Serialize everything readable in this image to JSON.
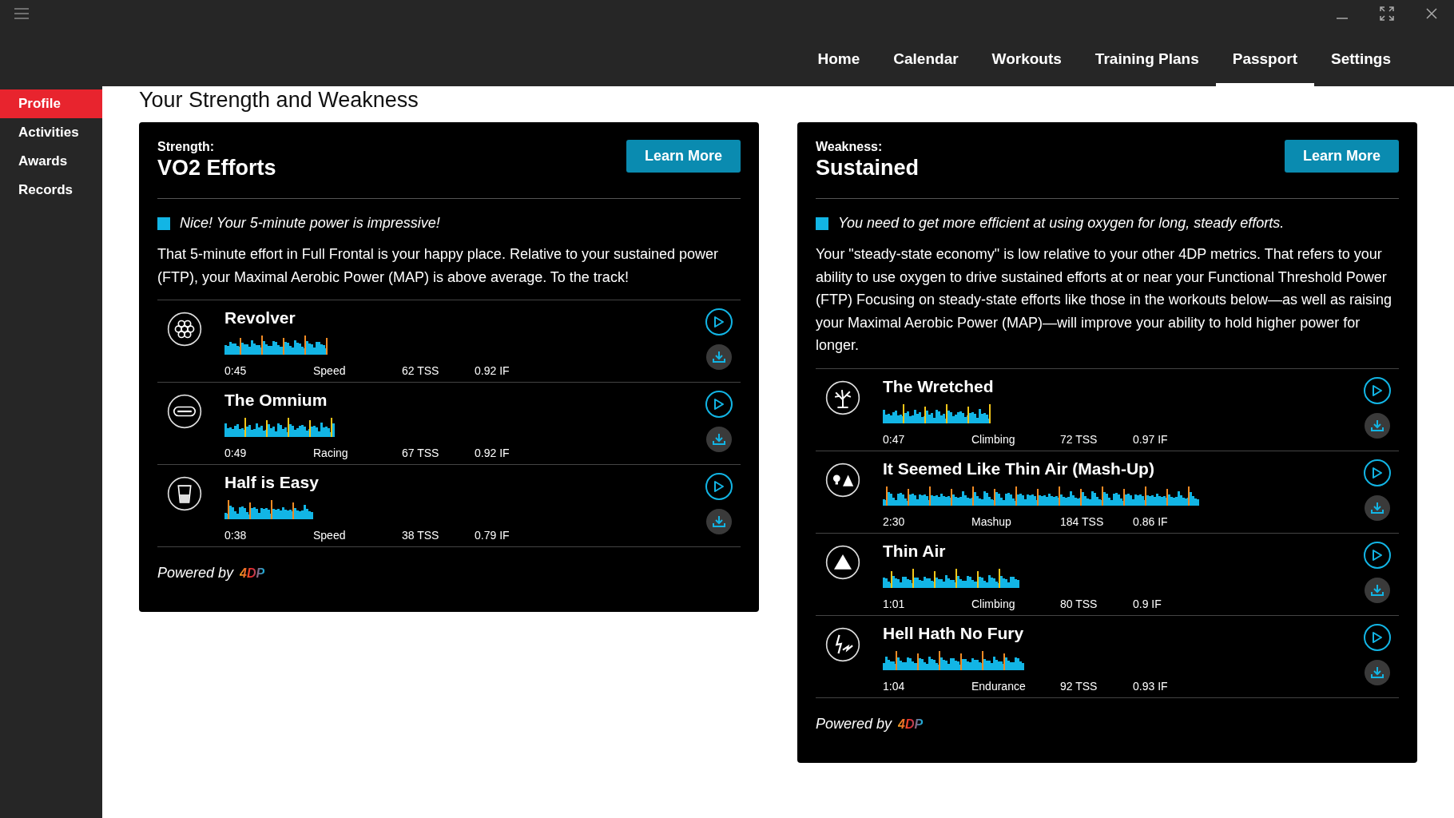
{
  "nav": [
    {
      "label": "Home",
      "selected": false
    },
    {
      "label": "Calendar",
      "selected": false
    },
    {
      "label": "Workouts",
      "selected": false
    },
    {
      "label": "Training Plans",
      "selected": false
    },
    {
      "label": "Passport",
      "selected": true
    },
    {
      "label": "Settings",
      "selected": false
    }
  ],
  "sidebar": {
    "items": [
      {
        "label": "Profile",
        "selected": true
      },
      {
        "label": "Activities",
        "selected": false
      },
      {
        "label": "Awards",
        "selected": false
      },
      {
        "label": "Records",
        "selected": false
      }
    ]
  },
  "heading": "Your Strength and Weakness",
  "cards": [
    {
      "label": "Strength:",
      "title": "VO2 Efforts",
      "button": "Learn More",
      "tip": "Nice! Your 5-minute power is impressive!",
      "body": "That 5-minute effort in Full Frontal is your happy place. Relative to your sustained power (FTP), your Maximal Aerobic Power (MAP) is above average. To the track!",
      "powered_by": "Powered by",
      "brand": "4DP",
      "workouts": [
        {
          "kind": "cylinder",
          "name": "Revolver",
          "duration": "0:45",
          "category": "Speed",
          "tss": "62 TSS",
          "if": "0.92 IF"
        },
        {
          "kind": "track",
          "name": "The Omnium",
          "duration": "0:49",
          "category": "Racing",
          "tss": "67 TSS",
          "if": "0.92 IF"
        },
        {
          "kind": "glass",
          "name": "Half is Easy",
          "duration": "0:38",
          "category": "Speed",
          "tss": "38 TSS",
          "if": "0.79 IF"
        }
      ]
    },
    {
      "label": "Weakness:",
      "title": "Sustained",
      "button": "Learn More",
      "tip": "You need to get more efficient at using oxygen for long, steady efforts.",
      "body": "Your \"steady-state economy\" is low relative to your other 4DP metrics. That refers to your ability to use oxygen to drive sustained efforts at or near your Functional Threshold Power (FTP) Focusing on steady-state efforts like those in the workouts below—as well as raising your Maximal Aerobic Power (MAP)—will improve your ability to hold higher power for longer.",
      "powered_by": "Powered by",
      "brand": "4DP",
      "workouts": [
        {
          "kind": "tree",
          "name": "The Wretched",
          "duration": "0:47",
          "category": "Climbing",
          "tss": "72 TSS",
          "if": "0.97 IF"
        },
        {
          "kind": "bulbpeak",
          "name": "It Seemed Like Thin Air (Mash-Up)",
          "duration": "2:30",
          "category": "Mashup",
          "tss": "184 TSS",
          "if": "0.86 IF"
        },
        {
          "kind": "peak",
          "name": "Thin Air",
          "duration": "1:01",
          "category": "Climbing",
          "tss": "80 TSS",
          "if": "0.9 IF"
        },
        {
          "kind": "lightning",
          "name": "Hell Hath No Fury",
          "duration": "1:04",
          "category": "Endurance",
          "tss": "92 TSS",
          "if": "0.93 IF"
        }
      ]
    }
  ]
}
